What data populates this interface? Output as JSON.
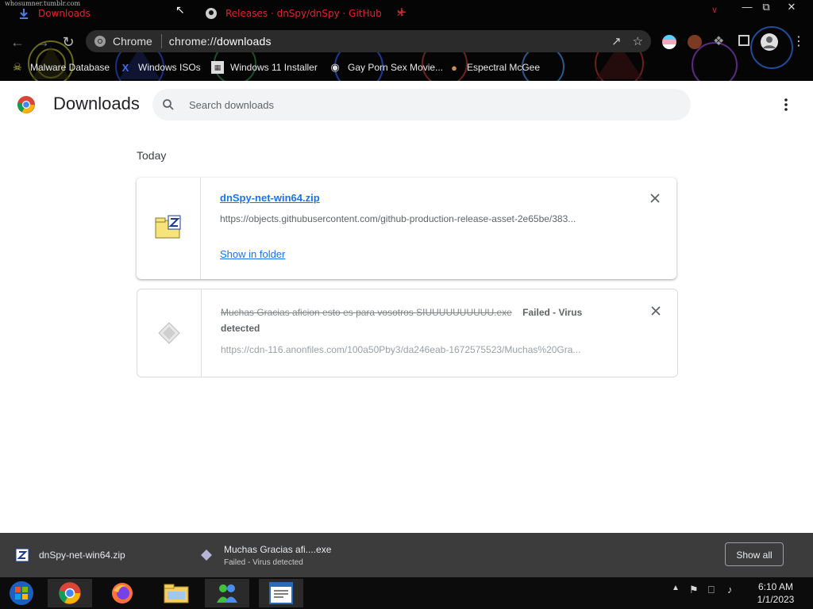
{
  "tabs": [
    {
      "label": "Downloads",
      "active": true,
      "icon": "download-icon"
    },
    {
      "label": "Releases · dnSpy/dnSpy · GitHub",
      "active": false,
      "icon": "github-icon"
    }
  ],
  "theme_tag": "whosumner.tumblr.com",
  "omnibox": {
    "chip_label": "Chrome",
    "url_prefix": "chrome://",
    "url_host": "downloads"
  },
  "bookmarks": [
    {
      "label": "Malware Database",
      "icon": "malware-db-icon"
    },
    {
      "label": "Windows ISOs",
      "icon": "x-logo-icon"
    },
    {
      "label": "Windows 11 Installer",
      "icon": "installer-icon"
    },
    {
      "label": "Gay Porn Sex Movie...",
      "icon": "site-icon"
    },
    {
      "label": "Espectral McGee",
      "icon": "site-icon"
    }
  ],
  "page": {
    "title": "Downloads",
    "search_placeholder": "Search downloads",
    "section": "Today"
  },
  "downloads": [
    {
      "name": "dnSpy-net-win64.zip",
      "url": "https://objects.githubusercontent.com/github-production-release-asset-2e65be/383...",
      "action": "Show in folder",
      "status": "complete"
    },
    {
      "name": "Muchas Gracias aficion esto es para vosotros SIUUUUUUUUUU.exe",
      "status_line1": "Failed - Virus",
      "status_line2": "detected",
      "url": "https://cdn-116.anonfiles.com/100a50Pby3/da246eab-1672575523/Muchas%20Gra...",
      "status": "failed"
    }
  ],
  "shelf": {
    "items": [
      {
        "name": "dnSpy-net-win64.zip"
      },
      {
        "name": "Muchas Gracias afi....exe",
        "status": "Failed - Virus detected"
      }
    ],
    "show_all": "Show all"
  },
  "taskbar": {
    "apps": [
      "start-orb-icon",
      "chrome-icon",
      "firefox-icon",
      "file-explorer-icon",
      "messenger-icon",
      "document-icon"
    ],
    "time": "6:10 AM",
    "date": "1/1/2023"
  },
  "colors": {
    "link_blue": "#1a73e8",
    "tab_red": "#e0242a",
    "shelf_bg": "#3c3c3c"
  }
}
